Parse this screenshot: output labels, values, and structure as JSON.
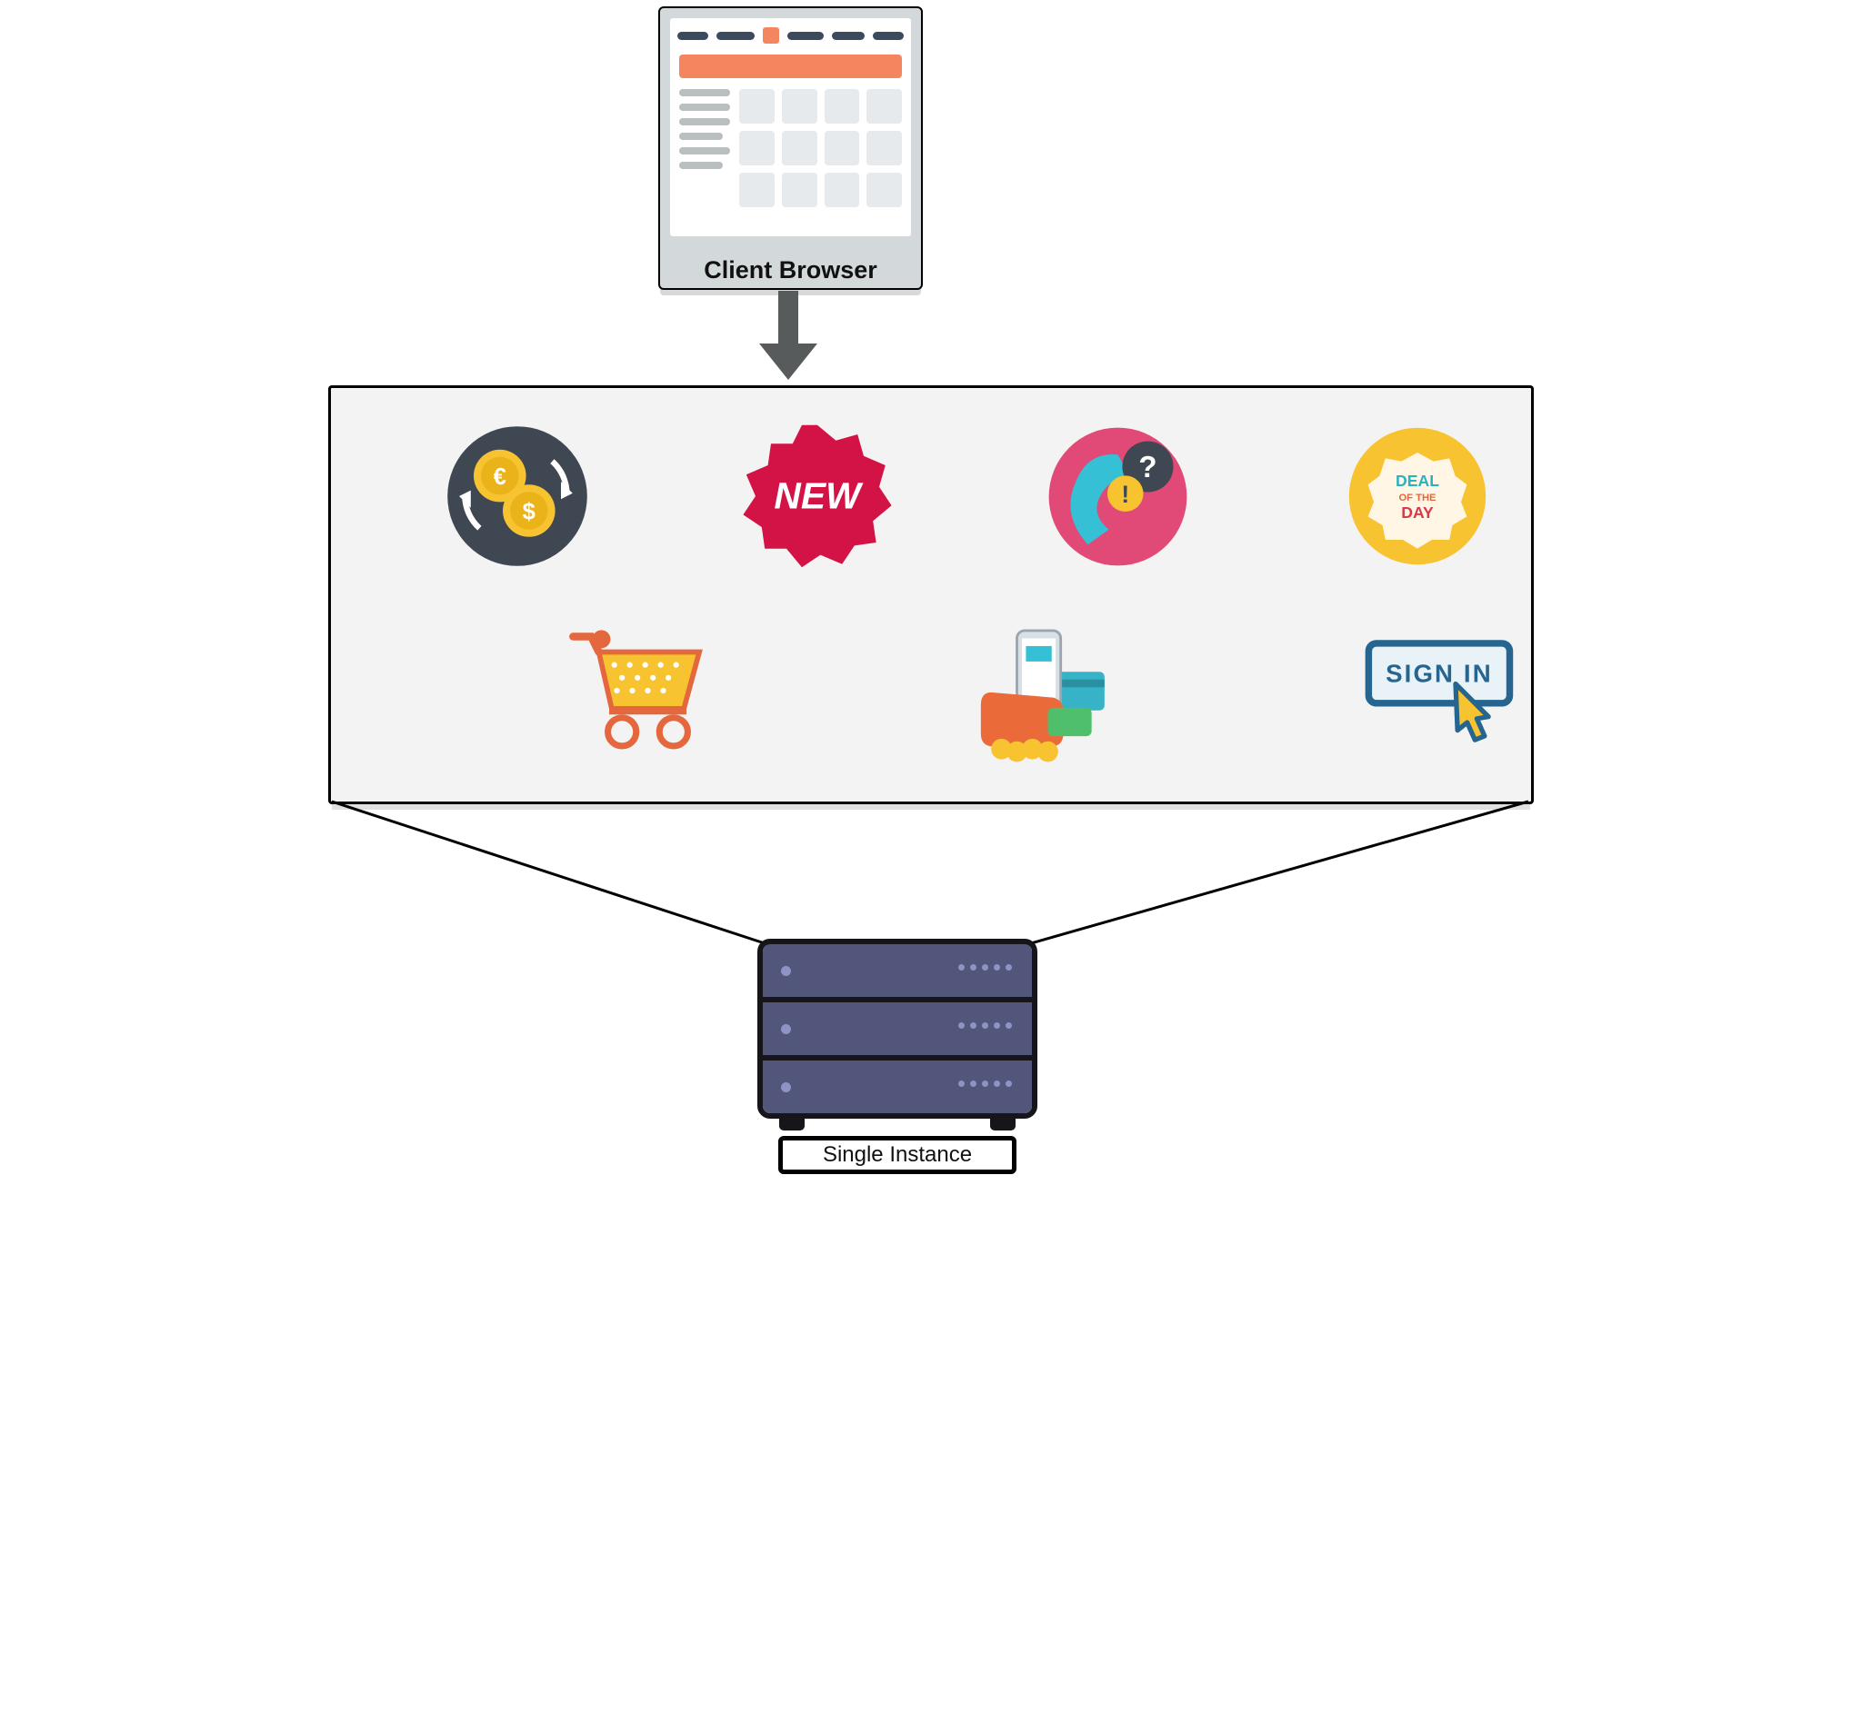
{
  "labels": {
    "browser": "Client Browser",
    "server": "Single Instance"
  },
  "icons": {
    "new_badge": "NEW",
    "deal_line1": "DEAL",
    "deal_line2": "OF THE",
    "deal_line3": "DAY",
    "signin": "SIGN IN"
  },
  "services": {
    "row1": [
      "currency-exchange",
      "new-badge",
      "phone-support",
      "deal-of-the-day"
    ],
    "row2": [
      "shopping-cart",
      "mobile-checkout",
      "sign-in"
    ]
  },
  "colors": {
    "coral": "#f4865f",
    "navy": "#3c4a5d",
    "red": "#d31245",
    "yellow": "#f7c331",
    "teal": "#2ab2bf",
    "blue": "#25658f",
    "server": "#52567a"
  }
}
